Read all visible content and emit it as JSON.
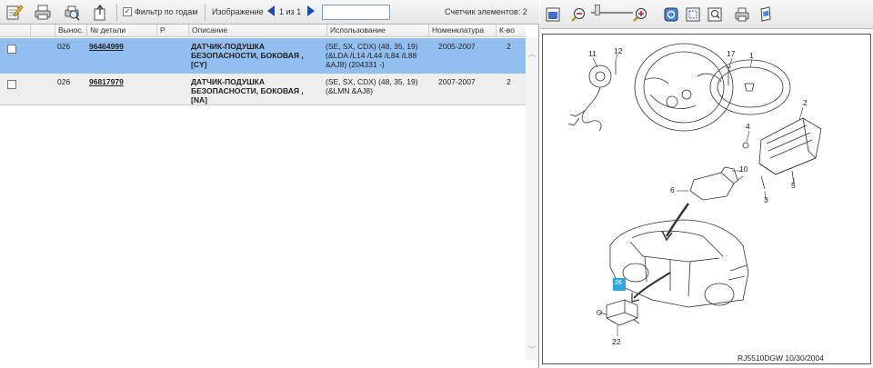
{
  "toolbar": {
    "year_filter_label": "Фильтр по годам",
    "year_filter_checked": "✓",
    "image_label": "Изображение",
    "page_indicator": "1 из 1",
    "search_value": "",
    "count_label": "Счетчик элементов: 2"
  },
  "columns": [
    "Вынос.",
    "№ детали",
    "P",
    "Описание",
    "Использование",
    "Номенклатура",
    "К-во"
  ],
  "rows": [
    {
      "callout": "026",
      "part_number": "96464999",
      "p": "",
      "description": "ДАТЧИК-ПОДУШКА БЕЗОПАСНОСТИ, БОКОВАЯ , [CY]",
      "usage": "(SE, SX, CDX) (48, 35, 19) (&LDA /L14 /L44 /L84 /L88 &AJ8) (204331 -)",
      "nomenclature": "2005-2007",
      "qty": "2"
    },
    {
      "callout": "026",
      "part_number": "96817979",
      "p": "",
      "description": "ДАТЧИК-ПОДУШКА БЕЗОПАСНОСТИ, БОКОВАЯ , [NA]",
      "usage": "(SE, SX, CDX) (48, 35, 19) (&LMN &AJ8)",
      "nomenclature": "2007-2007",
      "qty": "2"
    }
  ],
  "diagram": {
    "callouts": [
      "11",
      "12",
      "17",
      "1",
      "2",
      "4",
      "10",
      "6",
      "3",
      "5",
      "26",
      "22"
    ],
    "footer": "RJ5510DGW  10/30/2004"
  },
  "colors": {
    "selected_row": "#92bff0",
    "alt_row": "#eeeeee",
    "highlight_callout": "#2fa6e0",
    "nav_arrow": "#1a4fb3"
  },
  "icons": [
    "edit-icon",
    "print-icon",
    "print-preview-icon",
    "export-icon",
    "fit-page-icon",
    "zoom-out-icon",
    "zoom-in-icon",
    "rotate-icon",
    "select-region-icon",
    "zoom-region-icon",
    "print-image-icon",
    "bookmark-icon"
  ]
}
